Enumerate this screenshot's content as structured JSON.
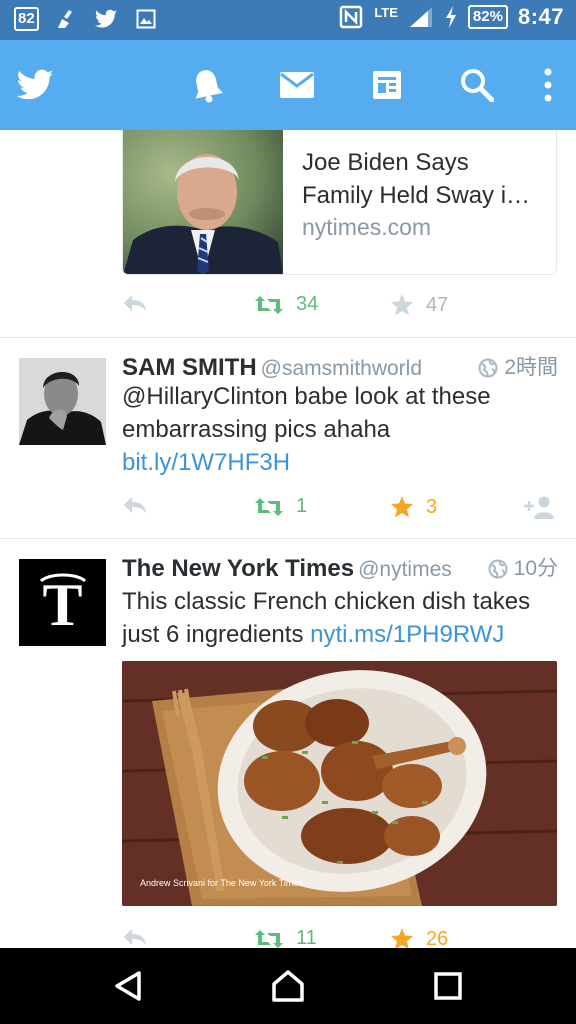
{
  "status_bar": {
    "left_badge": "82",
    "left_icons": [
      "broom-icon",
      "twitter-bird-icon",
      "image-icon"
    ],
    "network": "LTE",
    "battery": "82%",
    "time": "8:47"
  },
  "app_bar": {
    "icons": [
      "twitter-logo-icon",
      "notifications-bell-icon",
      "messages-envelope-icon",
      "moments-icon",
      "search-icon",
      "overflow-menu-icon"
    ]
  },
  "link_card": {
    "title": "Joe Biden Says Family Held Sway i…",
    "domain": "nytimes.com",
    "retweets": "34",
    "likes": "47"
  },
  "tweets": [
    {
      "name": "SAM SMITH",
      "handle": "@samsmithworld",
      "time": "2時間",
      "text_before": "@HillaryClinton babe look at these embarrassing pics ahaha ",
      "link": "bit.ly/1W7HF3H",
      "retweets": "1",
      "likes": "3"
    },
    {
      "name": "The New York Times",
      "handle": "@nytimes",
      "time": "10分",
      "text_before": "This classic French chicken dish takes just 6 ingredients ",
      "link": "nyti.ms/1PH9RWJ",
      "photo_credit": "Andrew Scrivani for The New York Times",
      "retweets": "11",
      "likes": "26"
    }
  ],
  "colors": {
    "status_bar": "#3d7ab8",
    "app_bar": "#55acee",
    "retweet_green": "#5fba7d",
    "like_orange": "#f5a623",
    "link_blue": "#3b94d9"
  }
}
